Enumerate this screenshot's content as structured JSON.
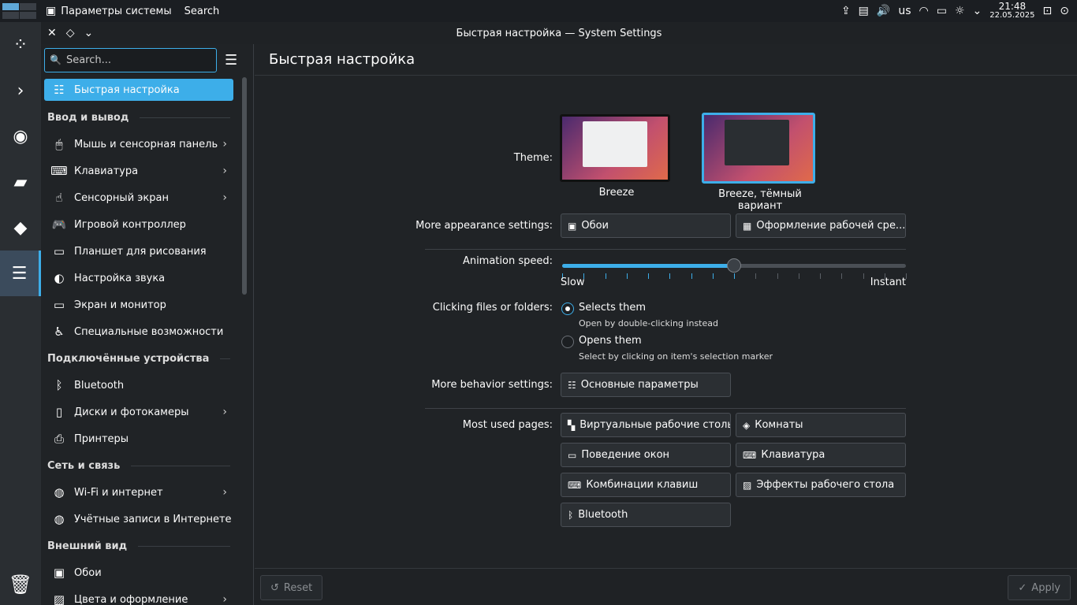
{
  "topbar": {
    "app_title": "Параметры системы",
    "search_label": "Search",
    "keyboard_layout": "us",
    "time": "21:48",
    "date": "22.05.2025"
  },
  "window": {
    "title": "Быстрая настройка — System Settings"
  },
  "sidebar": {
    "search_placeholder": "Search...",
    "selected_item": "Быстрая настройка",
    "sections": [
      {
        "title": "Ввод и вывод",
        "items": [
          {
            "label": "Мышь и сенсорная панель",
            "icon": "mouse-icon",
            "chevron": true
          },
          {
            "label": "Клавиатура",
            "icon": "keyboard-icon",
            "chevron": true
          },
          {
            "label": "Сенсорный экран",
            "icon": "touchscreen-icon",
            "chevron": true
          },
          {
            "label": "Игровой контроллер",
            "icon": "gamepad-icon",
            "chevron": false
          },
          {
            "label": "Планшет для рисования",
            "icon": "tablet-icon",
            "chevron": false
          },
          {
            "label": "Настройка звука",
            "icon": "audio-icon",
            "chevron": false
          },
          {
            "label": "Экран и монитор",
            "icon": "monitor-icon",
            "chevron": false
          },
          {
            "label": "Специальные возможности",
            "icon": "accessibility-icon",
            "chevron": false
          }
        ]
      },
      {
        "title": "Подключённые устройства",
        "items": [
          {
            "label": "Bluetooth",
            "icon": "bluetooth-icon",
            "chevron": false
          },
          {
            "label": "Диски и фотокамеры",
            "icon": "disk-icon",
            "chevron": true
          },
          {
            "label": "Принтеры",
            "icon": "printer-icon",
            "chevron": false
          }
        ]
      },
      {
        "title": "Сеть и связь",
        "items": [
          {
            "label": "Wi-Fi и интернет",
            "icon": "globe-icon",
            "chevron": true
          },
          {
            "label": "Учётные записи в Интернете",
            "icon": "online-accounts-icon",
            "chevron": false
          }
        ]
      },
      {
        "title": "Внешний вид",
        "items": [
          {
            "label": "Обои",
            "icon": "wallpaper-icon",
            "chevron": false
          },
          {
            "label": "Цвета и оформление",
            "icon": "colors-icon",
            "chevron": true
          }
        ]
      }
    ]
  },
  "main": {
    "header": "Быстрая настройка",
    "theme_label": "Theme:",
    "themes": [
      {
        "name": "Breeze",
        "selected": false
      },
      {
        "name": "Breeze, тёмный вариант",
        "selected": true
      }
    ],
    "appearance_label": "More appearance settings:",
    "appearance_buttons": [
      "Обои",
      "Оформление рабочей сре..."
    ],
    "animation_label": "Animation speed:",
    "animation_min": "Slow",
    "animation_max": "Instant",
    "animation_value": 0.5,
    "clicking_label": "Clicking files or folders:",
    "click_options": [
      {
        "label": "Selects them",
        "hint": "Open by double-clicking instead",
        "selected": true
      },
      {
        "label": "Opens them",
        "hint": "Select by clicking on item's selection marker",
        "selected": false
      }
    ],
    "behavior_label": "More behavior settings:",
    "behavior_button": "Основные параметры",
    "most_used_label": "Most used pages:",
    "most_used": [
      "Виртуальные рабочие столы",
      "Комнаты",
      "Поведение окон",
      "Клавиатура",
      "Комбинации клавиш",
      "Эффекты рабочего стола",
      "Bluetooth"
    ]
  },
  "footer": {
    "reset": "Reset",
    "apply": "Apply"
  },
  "colors": {
    "accent": "#3daee9",
    "background": "#202326"
  }
}
